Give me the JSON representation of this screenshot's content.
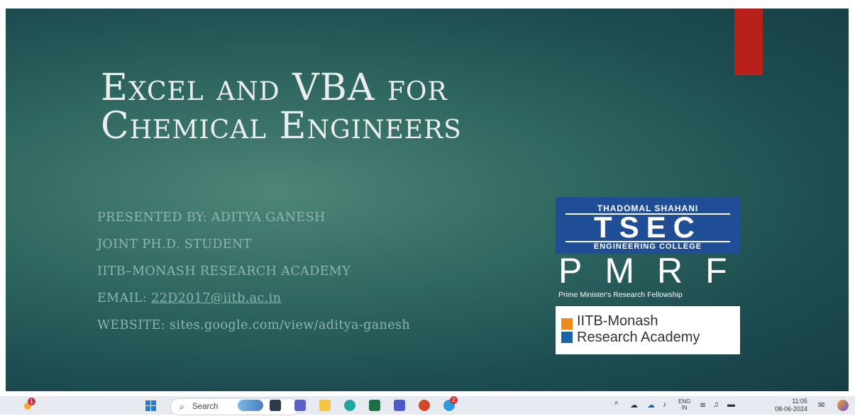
{
  "slide": {
    "title_line1": "Excel and VBA for",
    "title_line2": "Chemical Engineers",
    "presenter": "PRESENTED BY: ADITYA GANESH",
    "role": "JOINT PH.D. STUDENT",
    "academy": "IITB–MONASH RESEARCH ACADEMY",
    "email_label": "EMAIL: ",
    "email_value": "22D2017@iitb.ac.in",
    "website": "WEBSITE: sites.google.com/view/aditya-ganesh",
    "logos": {
      "tsec_top": "THADOMAL SHAHANI",
      "tsec_main": "TSEC",
      "tsec_bottom": "ENGINEERING COLLEGE",
      "pmrf_main": "PMRF",
      "pmrf_sub": "Prime Minister's Research Fellowship",
      "monash_line1": "IITB-Monash",
      "monash_line2": "Research Academy"
    }
  },
  "taskbar": {
    "weather_badge": "1",
    "search_placeholder": "Search",
    "teams_badge": "2",
    "language_top": "ENG",
    "language_bottom": "IN",
    "time": "11:05",
    "date": "08-06-2024",
    "icons": [
      "weather-icon",
      "start-icon",
      "search-icon",
      "landscape-widget-icon",
      "file-icon",
      "teams-icon",
      "file-explorer-icon",
      "edge-icon",
      "excel-icon",
      "teams-chat-icon",
      "powerpoint-icon",
      "copilot-icon",
      "chevron-up-icon",
      "onedrive-icon",
      "cloud-icon",
      "microphone-icon",
      "wifi-icon",
      "volume-icon",
      "battery-icon",
      "notification-icon",
      "copilot-tray-icon"
    ]
  }
}
